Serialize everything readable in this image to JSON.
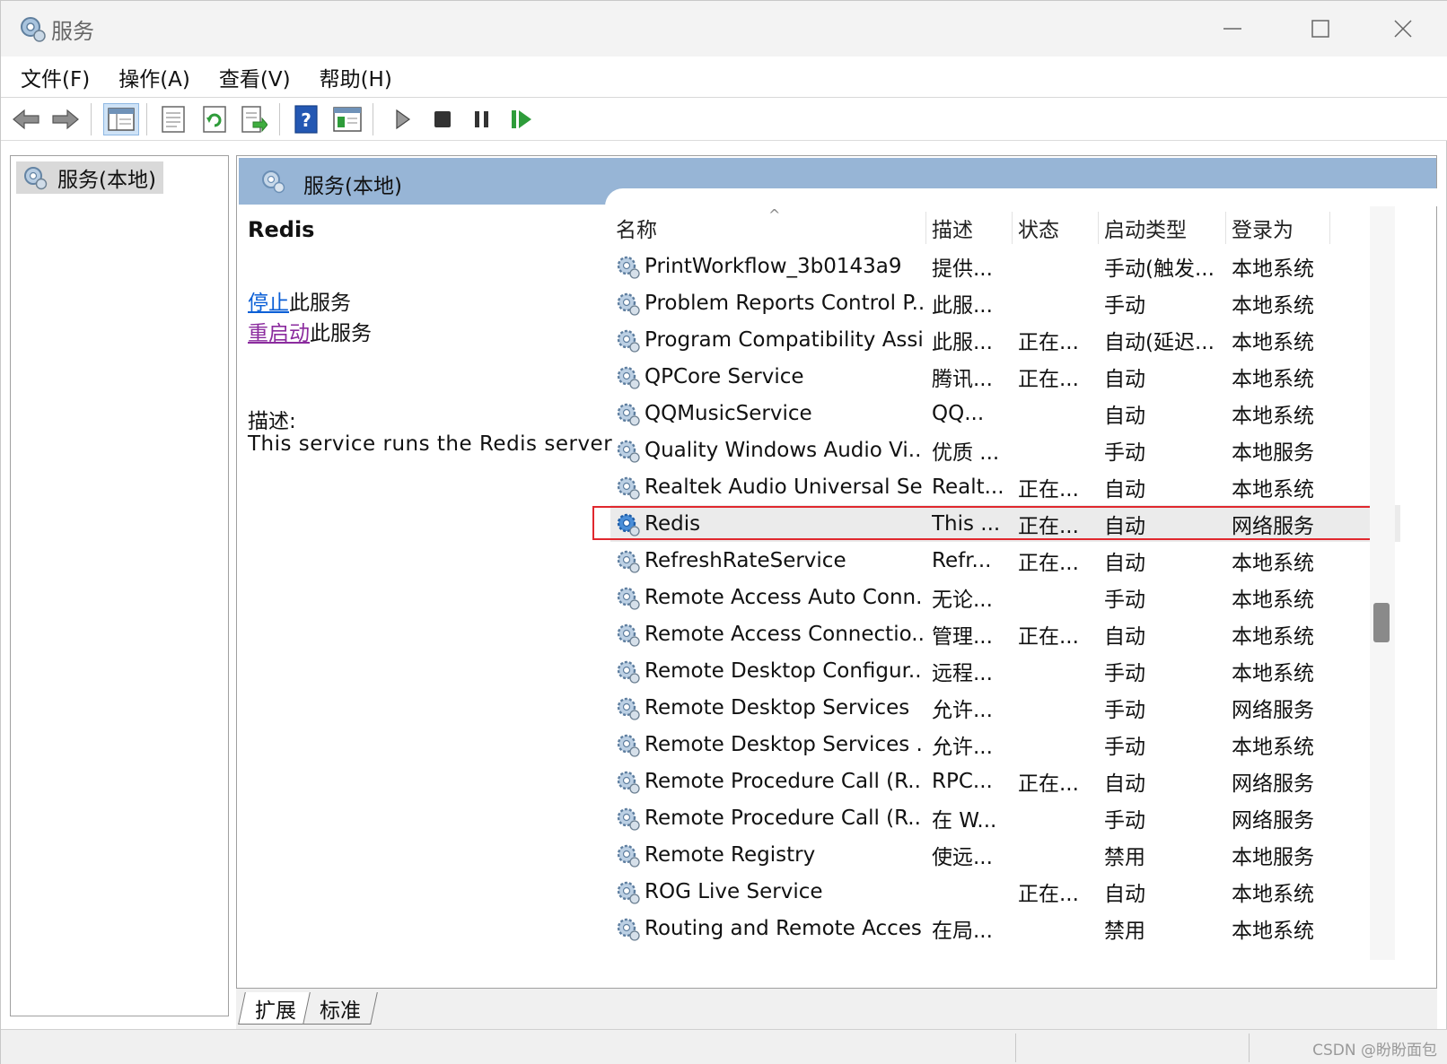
{
  "window": {
    "title": "服务"
  },
  "menu": [
    "文件(F)",
    "操作(A)",
    "查看(V)",
    "帮助(H)"
  ],
  "toolbar": {
    "buttons": [
      "back-icon",
      "forward-icon",
      "show-hide-tree-icon",
      "properties-icon",
      "refresh-icon",
      "export-list-icon",
      "help-icon",
      "view-icon",
      "start-service-icon",
      "stop-service-icon",
      "pause-service-icon",
      "restart-service-icon"
    ]
  },
  "tree": {
    "root_label": "服务(本地)"
  },
  "panel": {
    "header": "服务(本地)"
  },
  "detail": {
    "service_name": "Redis",
    "stop_link": "停止",
    "stop_suffix": "此服务",
    "restart_link": "重启动",
    "restart_suffix": "此服务",
    "desc_label": "描述:",
    "desc_text": "This service runs the Redis server"
  },
  "columns": {
    "name": "名称",
    "desc": "描述",
    "status": "状态",
    "start": "启动类型",
    "logon": "登录为"
  },
  "services": [
    {
      "name": "PrintWorkflow_3b0143a9",
      "desc": "提供...",
      "status": "",
      "start": "手动(触发...",
      "logon": "本地系统"
    },
    {
      "name": "Problem Reports Control P...",
      "desc": "此服...",
      "status": "",
      "start": "手动",
      "logon": "本地系统"
    },
    {
      "name": "Program Compatibility Assi...",
      "desc": "此服...",
      "status": "正在...",
      "start": "自动(延迟...",
      "logon": "本地系统"
    },
    {
      "name": "QPCore Service",
      "desc": "腾讯...",
      "status": "正在...",
      "start": "自动",
      "logon": "本地系统"
    },
    {
      "name": "QQMusicService",
      "desc": "QQ...",
      "status": "",
      "start": "自动",
      "logon": "本地系统"
    },
    {
      "name": "Quality Windows Audio Vi...",
      "desc": "优质 ...",
      "status": "",
      "start": "手动",
      "logon": "本地服务"
    },
    {
      "name": "Realtek Audio Universal Se...",
      "desc": "Realt...",
      "status": "正在...",
      "start": "自动",
      "logon": "本地系统"
    },
    {
      "name": "Redis",
      "desc": "This ...",
      "status": "正在...",
      "start": "自动",
      "logon": "网络服务"
    },
    {
      "name": "RefreshRateService",
      "desc": "Refr...",
      "status": "正在...",
      "start": "自动",
      "logon": "本地系统"
    },
    {
      "name": "Remote Access Auto Conn...",
      "desc": "无论...",
      "status": "",
      "start": "手动",
      "logon": "本地系统"
    },
    {
      "name": "Remote Access Connectio...",
      "desc": "管理...",
      "status": "正在...",
      "start": "自动",
      "logon": "本地系统"
    },
    {
      "name": "Remote Desktop Configur...",
      "desc": "远程...",
      "status": "",
      "start": "手动",
      "logon": "本地系统"
    },
    {
      "name": "Remote Desktop Services",
      "desc": "允许...",
      "status": "",
      "start": "手动",
      "logon": "网络服务"
    },
    {
      "name": "Remote Desktop Services ...",
      "desc": "允许...",
      "status": "",
      "start": "手动",
      "logon": "本地系统"
    },
    {
      "name": "Remote Procedure Call (R...",
      "desc": "RPC...",
      "status": "正在...",
      "start": "自动",
      "logon": "网络服务"
    },
    {
      "name": "Remote Procedure Call (R...",
      "desc": "在 W...",
      "status": "",
      "start": "手动",
      "logon": "网络服务"
    },
    {
      "name": "Remote Registry",
      "desc": "使远...",
      "status": "",
      "start": "禁用",
      "logon": "本地服务"
    },
    {
      "name": "ROG Live Service",
      "desc": "",
      "status": "正在...",
      "start": "自动",
      "logon": "本地系统"
    },
    {
      "name": "Routing and Remote Access",
      "desc": "在局...",
      "status": "",
      "start": "禁用",
      "logon": "本地系统"
    }
  ],
  "selected_service": "Redis",
  "tabs": [
    "扩展",
    "标准"
  ],
  "watermark": "CSDN @盼盼面包",
  "colors": {
    "header_bar": "#97b5d6",
    "highlight_box": "#e0282e",
    "stop_link": "#0b5fd6",
    "restart_link": "#8b2b9e"
  }
}
